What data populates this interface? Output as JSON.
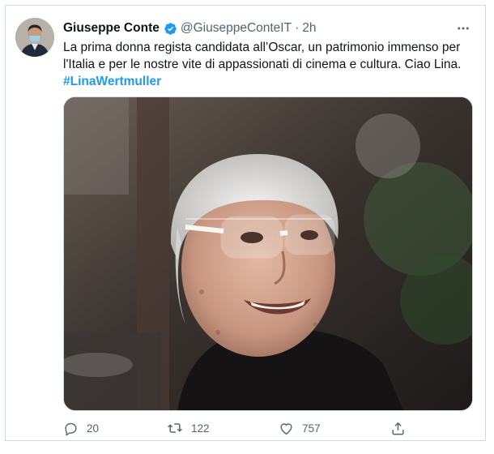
{
  "tweet": {
    "author_name": "Giuseppe Conte",
    "handle": "@GiuseppeConteIT",
    "separator": "·",
    "time": "2h",
    "text": "La prima donna regista candidata all’Oscar, un patrimonio immenso per l'Italia e per le nostre vite di appassionati di cinema e cultura. Ciao Lina.",
    "hashtag": "#LinaWertmuller"
  },
  "actions": {
    "replies": "20",
    "retweets": "122",
    "likes": "757"
  },
  "icons": {
    "verified": "verified-badge-icon",
    "more": "more-options-icon",
    "reply": "reply-icon",
    "retweet": "retweet-icon",
    "like": "heart-icon",
    "share": "share-icon"
  },
  "colors": {
    "accent": "#1d9bf0",
    "text": "#0f1419",
    "secondary": "#536471",
    "border": "#cfd9de"
  }
}
